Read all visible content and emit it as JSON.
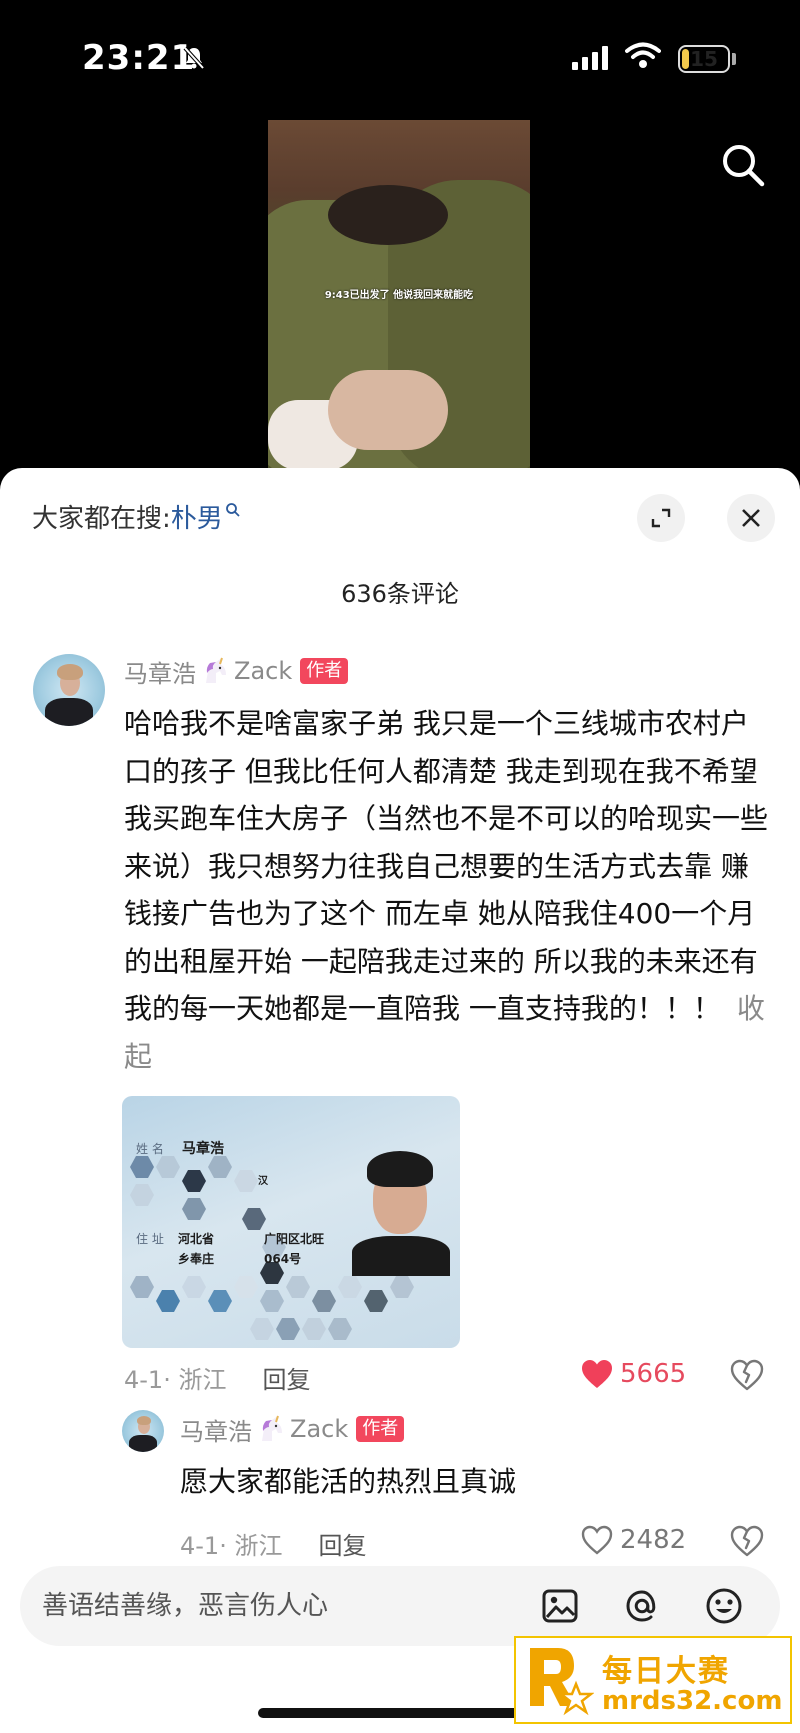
{
  "status_bar": {
    "time": "23:21",
    "battery": "15",
    "battery_level": 0.15
  },
  "video": {
    "caption": "9:43已出发了 他说我回来就能吃"
  },
  "comments_panel": {
    "hot_search_prefix": "大家都在搜:",
    "hot_search_term": "朴男",
    "comment_count": "636条评论"
  },
  "comments": [
    {
      "username": "马章浩",
      "username_suffix": "Zack",
      "badge": "作者",
      "text": "哈哈我不是啥富家子弟 我只是一个三线城市农村户口的孩子 但我比任何人都清楚 我走到现在我不希望我买跑车住大房子（当然也不是不可以的哈现实一些来说）我只想努力往我自己想要的生活方式去靠 赚钱接广告也为了这个 而左卓 她从陪我住400一个月的出租屋开始 一起陪我走过来的 所以我的未来还有我的每一天她都是一直陪我 一直支持我的！！！",
      "collapse_label": "收起",
      "id_card": {
        "name_label": "姓 名",
        "name": "马章浩",
        "address_label": "住 址",
        "address_line1_left": "河北省",
        "address_line1_right": "广阳区北旺",
        "address_line2_left": "乡奉庄",
        "address_line2_right": "064号",
        "fragment": "汉"
      },
      "meta": "4-1· 浙江",
      "reply_label": "回复",
      "likes": "5665",
      "liked": true
    },
    {
      "username": "马章浩",
      "username_suffix": "Zack",
      "badge": "作者",
      "text": "愿大家都能活的热烈且真诚",
      "meta": "4-1· 浙江",
      "reply_label": "回复",
      "likes": "2482",
      "liked": false
    }
  ],
  "input": {
    "placeholder": "善语结善缘，恶言伤人心"
  },
  "watermark": {
    "title": "每日大赛",
    "url": "mrds32.com"
  },
  "colors": {
    "accent_red": "#f2475d",
    "link_blue": "#2b5a9c",
    "watermark_gold": "#f0a500"
  }
}
